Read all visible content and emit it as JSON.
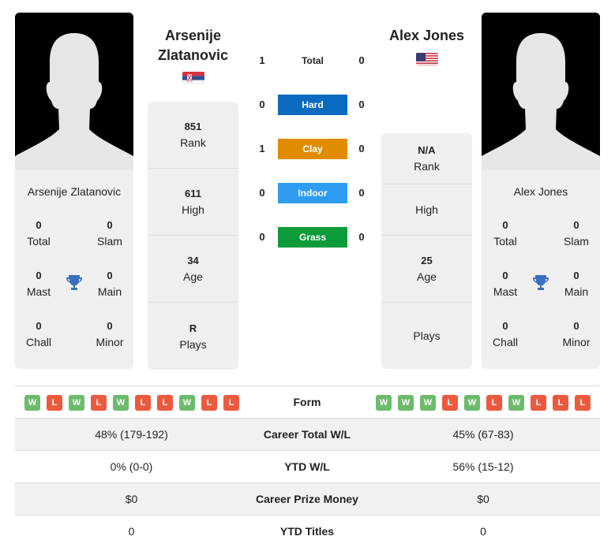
{
  "colors": {
    "hard": "#0a6abf",
    "clay": "#e08b00",
    "indoor": "#2e9cf2",
    "grass": "#0c9a3a",
    "win": "#6cbb6c",
    "loss": "#ec5a3e",
    "trophy": "#3a6fbf"
  },
  "player1": {
    "name_line1": "Arsenije",
    "name_line2": "Zlatanovic",
    "full_name": "Arsenije Zlatanovic",
    "flag": "serbia-flag",
    "titles": {
      "total": {
        "value": "0",
        "label": "Total"
      },
      "slam": {
        "value": "0",
        "label": "Slam"
      },
      "mast": {
        "value": "0",
        "label": "Mast"
      },
      "main": {
        "value": "0",
        "label": "Main"
      },
      "chall": {
        "value": "0",
        "label": "Chall"
      },
      "minor": {
        "value": "0",
        "label": "Minor"
      }
    },
    "stats": {
      "rank": {
        "value": "851",
        "label": "Rank"
      },
      "high": {
        "value": "611",
        "label": "High"
      },
      "age": {
        "value": "34",
        "label": "Age"
      },
      "plays": {
        "value": "R",
        "label": "Plays"
      }
    },
    "form": [
      "W",
      "L",
      "W",
      "L",
      "W",
      "L",
      "L",
      "W",
      "L",
      "L"
    ]
  },
  "player2": {
    "name": "Alex Jones",
    "full_name": "Alex Jones",
    "flag": "usa-flag",
    "titles": {
      "total": {
        "value": "0",
        "label": "Total"
      },
      "slam": {
        "value": "0",
        "label": "Slam"
      },
      "mast": {
        "value": "0",
        "label": "Mast"
      },
      "main": {
        "value": "0",
        "label": "Main"
      },
      "chall": {
        "value": "0",
        "label": "Chall"
      },
      "minor": {
        "value": "0",
        "label": "Minor"
      }
    },
    "stats": {
      "rank": {
        "value": "N/A",
        "label": "Rank"
      },
      "high": {
        "value": "",
        "label": "High"
      },
      "age": {
        "value": "25",
        "label": "Age"
      },
      "plays": {
        "value": "",
        "label": "Plays"
      }
    },
    "form": [
      "W",
      "W",
      "W",
      "L",
      "W",
      "L",
      "W",
      "L",
      "L",
      "L"
    ]
  },
  "h2h": [
    {
      "label": "Total",
      "p1": "1",
      "p2": "0",
      "style": "plain"
    },
    {
      "label": "Hard",
      "p1": "0",
      "p2": "0",
      "style": "hard"
    },
    {
      "label": "Clay",
      "p1": "1",
      "p2": "0",
      "style": "clay"
    },
    {
      "label": "Indoor",
      "p1": "0",
      "p2": "0",
      "style": "indoor"
    },
    {
      "label": "Grass",
      "p1": "0",
      "p2": "0",
      "style": "grass"
    }
  ],
  "comparison": {
    "form_label": "Form",
    "rows": [
      {
        "label": "Career Total W/L",
        "p1": "48% (179-192)",
        "p2": "45% (67-83)"
      },
      {
        "label": "YTD W/L",
        "p1": "0% (0-0)",
        "p2": "56% (15-12)"
      },
      {
        "label": "Career Prize Money",
        "p1": "$0",
        "p2": "$0"
      },
      {
        "label": "YTD Titles",
        "p1": "0",
        "p2": "0"
      }
    ]
  }
}
